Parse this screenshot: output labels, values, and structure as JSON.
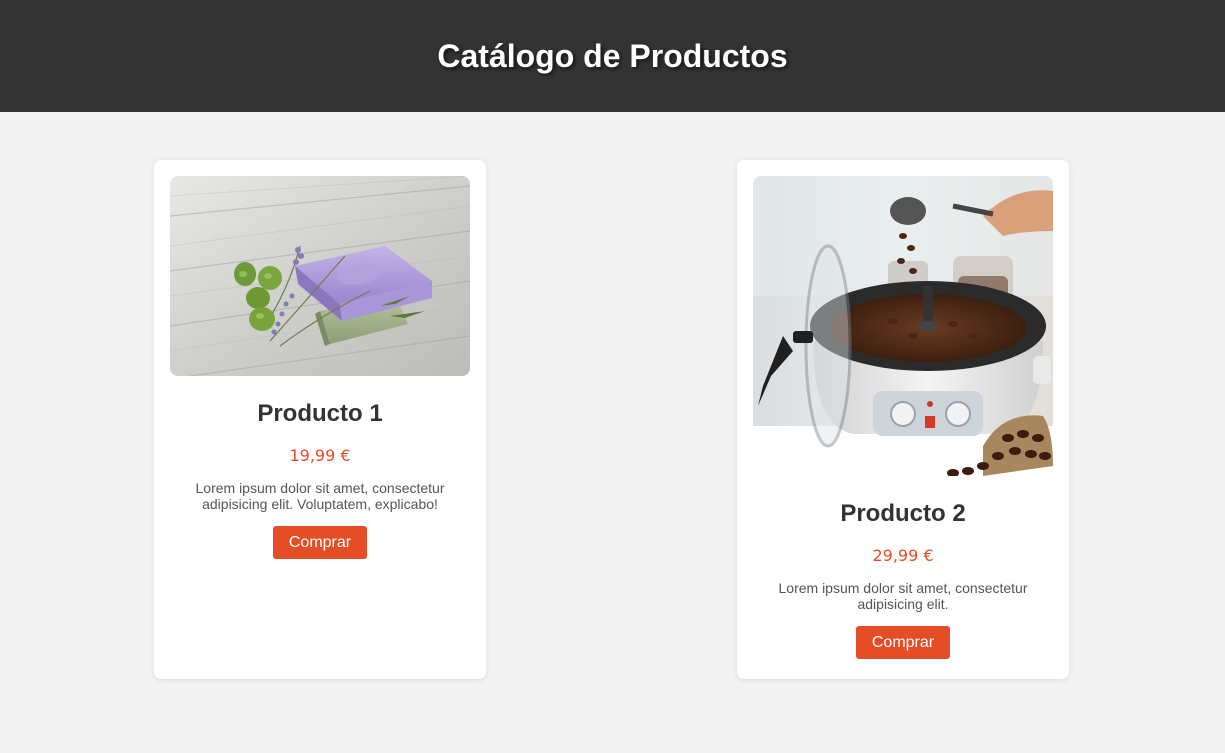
{
  "header": {
    "title": "Catálogo de Productos"
  },
  "products": [
    {
      "name": "Producto 1",
      "price": "19,99 €",
      "description": "Lorem ipsum dolor sit amet, consectetur adipisicing elit. Voluptatem, explicabo!",
      "button_label": "Comprar",
      "image": "lavender-soap-bars-photo"
    },
    {
      "name": "Producto 2",
      "price": "29,99 €",
      "description": "Lorem ipsum dolor sit amet, consectetur adipisicing elit.",
      "button_label": "Comprar",
      "image": "coffee-roaster-machine-photo"
    }
  ],
  "colors": {
    "header_bg": "#333333",
    "accent": "#e44d26",
    "page_bg": "#f3f3f3",
    "card_bg": "#ffffff"
  }
}
